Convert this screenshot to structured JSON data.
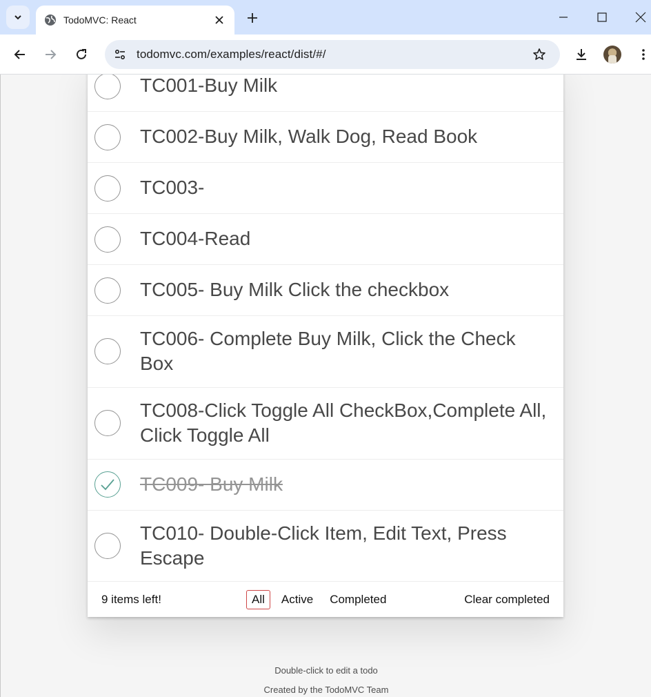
{
  "browser": {
    "tab_title": "TodoMVC: React",
    "url": "todomvc.com/examples/react/dist/#/"
  },
  "todos": [
    {
      "title": "TC001-Buy Milk",
      "completed": false
    },
    {
      "title": "TC002-Buy Milk, Walk Dog, Read Book",
      "completed": false
    },
    {
      "title": "TC003-",
      "completed": false
    },
    {
      "title": "TC004-Read",
      "completed": false
    },
    {
      "title": "TC005- Buy Milk Click the checkbox",
      "completed": false
    },
    {
      "title": "TC006- Complete Buy Milk, Click the Check Box",
      "completed": false
    },
    {
      "title": "TC008-Click Toggle All CheckBox,Complete All, Click Toggle All",
      "completed": false
    },
    {
      "title": "TC009- Buy Milk",
      "completed": true
    },
    {
      "title": "TC010- Double-Click Item, Edit Text, Press Escape",
      "completed": false
    }
  ],
  "footer": {
    "count_text": "9 items left!",
    "filters": [
      "All",
      "Active",
      "Completed"
    ],
    "selected_filter": "All",
    "clear_completed": "Clear completed"
  },
  "info": {
    "hint": "Double-click to edit a todo",
    "credit": "Created by the TodoMVC Team"
  },
  "colors": {
    "tabbar_bg": "#d3e3fd",
    "selected_filter_border": "#ce4646",
    "check_color": "#59a193"
  }
}
